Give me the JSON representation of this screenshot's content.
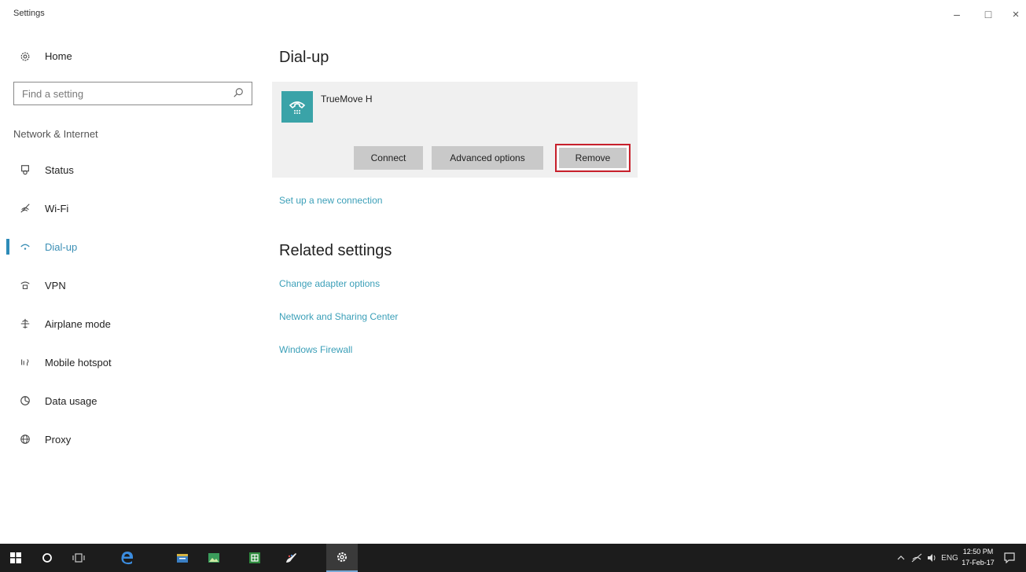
{
  "window": {
    "title": "Settings",
    "controls": {
      "minimize": "–",
      "maximize": "□",
      "close": "×"
    }
  },
  "sidebar": {
    "home_label": "Home",
    "search_placeholder": "Find a setting",
    "section_header": "Network & Internet",
    "items": [
      {
        "label": "Status",
        "icon": "status-icon",
        "active": false
      },
      {
        "label": "Wi-Fi",
        "icon": "wifi-icon",
        "active": false
      },
      {
        "label": "Dial-up",
        "icon": "dialup-icon",
        "active": true
      },
      {
        "label": "VPN",
        "icon": "vpn-icon",
        "active": false
      },
      {
        "label": "Airplane mode",
        "icon": "airplane-icon",
        "active": false
      },
      {
        "label": "Mobile hotspot",
        "icon": "hotspot-icon",
        "active": false
      },
      {
        "label": "Data usage",
        "icon": "data-usage-icon",
        "active": false
      },
      {
        "label": "Proxy",
        "icon": "proxy-icon",
        "active": false
      }
    ]
  },
  "main": {
    "title": "Dial-up",
    "connection": {
      "name": "TrueMove H",
      "icon": "phone-icon",
      "icon_bg": "#3aa3a8",
      "buttons": {
        "connect": "Connect",
        "advanced": "Advanced options",
        "remove": "Remove"
      }
    },
    "setup_link": "Set up a new connection",
    "related_title": "Related settings",
    "related_links": [
      "Change adapter options",
      "Network and Sharing Center",
      "Windows Firewall"
    ]
  },
  "taskbar": {
    "tray": {
      "language": "ENG",
      "time": "12:50 PM",
      "date": "17-Feb-17"
    }
  },
  "colors": {
    "accent": "#2d8bb8",
    "link": "#3b9fb8",
    "highlight_border": "#c8202c",
    "taskbar_bg": "#1c1c1c"
  }
}
